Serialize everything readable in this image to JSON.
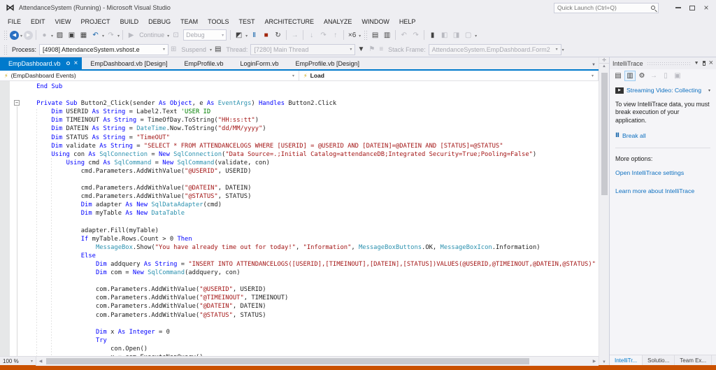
{
  "titlebar": {
    "title": "AttendanceSystem (Running) - Microsoft Visual Studio",
    "quick_launch_placeholder": "Quick Launch (Ctrl+Q)",
    "window_icons": [
      "search-icon",
      "minimize-icon",
      "maximize-icon",
      "close-icon"
    ]
  },
  "menubar": {
    "items": [
      "FILE",
      "EDIT",
      "VIEW",
      "PROJECT",
      "BUILD",
      "DEBUG",
      "TEAM",
      "TOOLS",
      "TEST",
      "ARCHITECTURE",
      "ANALYZE",
      "WINDOW",
      "HELP"
    ]
  },
  "toolbar": {
    "items": [
      {
        "type": "grip"
      },
      {
        "type": "icon",
        "name": "navigate-back-icon",
        "glyph": "◀",
        "variant": "circle-blue"
      },
      {
        "type": "dd"
      },
      {
        "type": "icon",
        "name": "navigate-forward-icon",
        "glyph": "▶",
        "variant": "circle-gray"
      },
      {
        "type": "sep"
      },
      {
        "type": "icon",
        "name": "new-project-icon",
        "glyph": "●",
        "variant": "disabled"
      },
      {
        "type": "dd"
      },
      {
        "type": "icon",
        "name": "open-file-icon",
        "glyph": "▨",
        "variant": "dark"
      },
      {
        "type": "icon",
        "name": "save-icon",
        "glyph": "▣",
        "variant": "dark"
      },
      {
        "type": "icon",
        "name": "save-all-icon",
        "glyph": "▦",
        "variant": "dark"
      },
      {
        "type": "icon",
        "name": "undo-icon",
        "glyph": "↶",
        "variant": "blue"
      },
      {
        "type": "dd"
      },
      {
        "type": "icon",
        "name": "redo-icon",
        "glyph": "↷",
        "variant": "disabled"
      },
      {
        "type": "dd"
      },
      {
        "type": "sep"
      },
      {
        "type": "icon",
        "name": "continue-icon",
        "glyph": "▶",
        "variant": "disabled"
      },
      {
        "type": "label",
        "name": "continue-button",
        "text": "Continue",
        "variant": "disabled"
      },
      {
        "type": "dd"
      },
      {
        "type": "icon",
        "name": "breakpoints-window-icon",
        "glyph": "⊡",
        "variant": "disabled"
      },
      {
        "type": "combo",
        "name": "solution-configurations-combo",
        "text": "Debug",
        "variant": "disabled"
      },
      {
        "type": "sep"
      },
      {
        "type": "icon",
        "name": "diagnostic-tools-icon",
        "glyph": "◩",
        "variant": "dark"
      },
      {
        "type": "dd"
      },
      {
        "type": "icon",
        "name": "break-all-icon",
        "glyph": "Ⅱ",
        "variant": "blue"
      },
      {
        "type": "icon",
        "name": "stop-debugging-icon",
        "glyph": "■",
        "variant": "red"
      },
      {
        "type": "icon",
        "name": "restart-icon",
        "glyph": "↻",
        "variant": "dark"
      },
      {
        "type": "sep"
      },
      {
        "type": "icon",
        "name": "show-next-statement-icon",
        "glyph": "→",
        "variant": "disabled"
      },
      {
        "type": "sep"
      },
      {
        "type": "icon",
        "name": "step-into-icon",
        "glyph": "↓",
        "variant": "disabled"
      },
      {
        "type": "icon",
        "name": "step-over-icon",
        "glyph": "↷",
        "variant": "disabled"
      },
      {
        "type": "icon",
        "name": "step-out-icon",
        "glyph": "↑",
        "variant": "disabled"
      },
      {
        "type": "sep"
      },
      {
        "type": "icon",
        "name": "hex-display-icon",
        "glyph": "×6",
        "variant": "dark"
      },
      {
        "type": "dd"
      },
      {
        "type": "grip"
      },
      {
        "type": "icon",
        "name": "memory-window-icon",
        "glyph": "▤",
        "variant": "dark"
      },
      {
        "type": "icon",
        "name": "watch-window-icon",
        "glyph": "▥",
        "variant": "dark"
      },
      {
        "type": "sep"
      },
      {
        "type": "icon",
        "name": "undo-close-icon",
        "glyph": "↶",
        "variant": "disabled"
      },
      {
        "type": "icon",
        "name": "redo-close-icon",
        "glyph": "↷",
        "variant": "disabled"
      },
      {
        "type": "sep"
      },
      {
        "type": "icon",
        "name": "toggle-bookmark-icon",
        "glyph": "▮",
        "variant": "dark"
      },
      {
        "type": "icon",
        "name": "prev-bookmark-icon",
        "glyph": "◧",
        "variant": "disabled"
      },
      {
        "type": "icon",
        "name": "next-bookmark-icon",
        "glyph": "◨",
        "variant": "disabled"
      },
      {
        "type": "icon",
        "name": "clear-bookmarks-icon",
        "glyph": "▢",
        "variant": "disabled"
      },
      {
        "type": "dd"
      }
    ]
  },
  "debug_location": {
    "process_label": "Process:",
    "process_value": "[4908] AttendanceSystem.vshost.e",
    "suspend_label": "Suspend",
    "thread_label": "Thread:",
    "thread_value": "[7280] Main Thread",
    "stack_frame_label": "Stack Frame:",
    "stack_frame_value": "AttendanceSystem.EmpDashboard.Form2",
    "icons": [
      "suspend-icon",
      "thread-icon",
      "filter-icon",
      "flag-icon",
      "stack-frame-icon"
    ]
  },
  "editor": {
    "tabs": [
      {
        "label": "EmpDashboard.vb",
        "active": true
      },
      {
        "label": "EmpDashboard.vb [Design]",
        "active": false
      },
      {
        "label": "EmpProfile.vb",
        "active": false
      },
      {
        "label": "LoginForm.vb",
        "active": false
      },
      {
        "label": "EmpProfile.vb [Design]",
        "active": false
      }
    ],
    "navbar_left": "(EmpDashboard Events)",
    "navbar_right": "Load",
    "zoom_level": "100 %",
    "code_lines": [
      [
        [
          "p",
          "    "
        ],
        [
          "k",
          "End Sub"
        ]
      ],
      [],
      [
        [
          "p",
          "    "
        ],
        [
          "k",
          "Private Sub"
        ],
        [
          "p",
          " Button2_Click(sender "
        ],
        [
          "k",
          "As"
        ],
        [
          "p",
          " "
        ],
        [
          "k",
          "Object"
        ],
        [
          "p",
          ", e "
        ],
        [
          "k",
          "As"
        ],
        [
          "p",
          " "
        ],
        [
          "t",
          "EventArgs"
        ],
        [
          "p",
          ") "
        ],
        [
          "k",
          "Handles"
        ],
        [
          "p",
          " Button2.Click"
        ]
      ],
      [
        [
          "p",
          "        "
        ],
        [
          "k",
          "Dim"
        ],
        [
          "p",
          " USERID "
        ],
        [
          "k",
          "As String"
        ],
        [
          "p",
          " = Label2.Text "
        ],
        [
          "c",
          "'USER ID"
        ]
      ],
      [
        [
          "p",
          "        "
        ],
        [
          "k",
          "Dim"
        ],
        [
          "p",
          " TIMEINOUT "
        ],
        [
          "k",
          "As String"
        ],
        [
          "p",
          " = TimeOfDay.ToString("
        ],
        [
          "s",
          "\"HH:ss:tt\""
        ],
        [
          "p",
          ")"
        ]
      ],
      [
        [
          "p",
          "        "
        ],
        [
          "k",
          "Dim"
        ],
        [
          "p",
          " DATEIN "
        ],
        [
          "k",
          "As String"
        ],
        [
          "p",
          " = "
        ],
        [
          "t",
          "DateTime"
        ],
        [
          "p",
          ".Now.ToString("
        ],
        [
          "s",
          "\"dd/MM/yyyy\""
        ],
        [
          "p",
          ")"
        ]
      ],
      [
        [
          "p",
          "        "
        ],
        [
          "k",
          "Dim"
        ],
        [
          "p",
          " STATUS "
        ],
        [
          "k",
          "As String"
        ],
        [
          "p",
          " = "
        ],
        [
          "s",
          "\"TimeOUT\""
        ]
      ],
      [
        [
          "p",
          "        "
        ],
        [
          "k",
          "Dim"
        ],
        [
          "p",
          " validate "
        ],
        [
          "k",
          "As String"
        ],
        [
          "p",
          " = "
        ],
        [
          "s",
          "\"SELECT * FROM ATTENDANCELOGS WHERE [USERID] = @USERID AND [DATEIN]=@DATEIN AND [STATUS]=@STATUS\""
        ]
      ],
      [
        [
          "p",
          "        "
        ],
        [
          "k",
          "Using"
        ],
        [
          "p",
          " con "
        ],
        [
          "k",
          "As"
        ],
        [
          "p",
          " "
        ],
        [
          "t",
          "SqlConnection"
        ],
        [
          "p",
          " = "
        ],
        [
          "k",
          "New"
        ],
        [
          "p",
          " "
        ],
        [
          "t",
          "SqlConnection"
        ],
        [
          "p",
          "("
        ],
        [
          "s",
          "\"Data Source=.;Initial Catalog=attendanceDB;Integrated Security=True;Pooling=False\""
        ],
        [
          "p",
          ")"
        ]
      ],
      [
        [
          "p",
          "            "
        ],
        [
          "k",
          "Using"
        ],
        [
          "p",
          " cmd "
        ],
        [
          "k",
          "As"
        ],
        [
          "p",
          " "
        ],
        [
          "t",
          "SqlCommand"
        ],
        [
          "p",
          " = "
        ],
        [
          "k",
          "New"
        ],
        [
          "p",
          " "
        ],
        [
          "t",
          "SqlCommand"
        ],
        [
          "p",
          "(validate, con)"
        ]
      ],
      [
        [
          "p",
          "                cmd.Parameters.AddWithValue("
        ],
        [
          "s",
          "\"@USERID\""
        ],
        [
          "p",
          ", USERID)"
        ]
      ],
      [],
      [
        [
          "p",
          "                cmd.Parameters.AddWithValue("
        ],
        [
          "s",
          "\"@DATEIN\""
        ],
        [
          "p",
          ", DATEIN)"
        ]
      ],
      [
        [
          "p",
          "                cmd.Parameters.AddWithValue("
        ],
        [
          "s",
          "\"@STATUS\""
        ],
        [
          "p",
          ", STATUS)"
        ]
      ],
      [
        [
          "p",
          "                "
        ],
        [
          "k",
          "Dim"
        ],
        [
          "p",
          " adapter "
        ],
        [
          "k",
          "As New"
        ],
        [
          "p",
          " "
        ],
        [
          "t",
          "SqlDataAdapter"
        ],
        [
          "p",
          "(cmd)"
        ]
      ],
      [
        [
          "p",
          "                "
        ],
        [
          "k",
          "Dim"
        ],
        [
          "p",
          " myTable "
        ],
        [
          "k",
          "As New"
        ],
        [
          "p",
          " "
        ],
        [
          "t",
          "DataTable"
        ]
      ],
      [],
      [
        [
          "p",
          "                adapter.Fill(myTable)"
        ]
      ],
      [
        [
          "p",
          "                "
        ],
        [
          "k",
          "If"
        ],
        [
          "p",
          " myTable.Rows.Count > 0 "
        ],
        [
          "k",
          "Then"
        ]
      ],
      [
        [
          "p",
          "                    "
        ],
        [
          "t",
          "MessageBox"
        ],
        [
          "p",
          ".Show("
        ],
        [
          "s",
          "\"You have already time out for today!\""
        ],
        [
          "p",
          ", "
        ],
        [
          "s",
          "\"Information\""
        ],
        [
          "p",
          ", "
        ],
        [
          "t",
          "MessageBoxButtons"
        ],
        [
          "p",
          ".OK, "
        ],
        [
          "t",
          "MessageBoxIcon"
        ],
        [
          "p",
          ".Information)"
        ]
      ],
      [
        [
          "p",
          "                "
        ],
        [
          "k",
          "Else"
        ]
      ],
      [
        [
          "p",
          "                    "
        ],
        [
          "k",
          "Dim"
        ],
        [
          "p",
          " addquery "
        ],
        [
          "k",
          "As String"
        ],
        [
          "p",
          " = "
        ],
        [
          "s",
          "\"INSERT INTO ATTENDANCELOGS([USERID],[TIMEINOUT],[DATEIN],[STATUS])VALUES(@USERID,@TIMEINOUT,@DATEIN,@STATUS)\""
        ]
      ],
      [
        [
          "p",
          "                    "
        ],
        [
          "k",
          "Dim"
        ],
        [
          "p",
          " com = "
        ],
        [
          "k",
          "New"
        ],
        [
          "p",
          " "
        ],
        [
          "t",
          "SqlCommand"
        ],
        [
          "p",
          "(addquery, con)"
        ]
      ],
      [],
      [
        [
          "p",
          "                    com.Parameters.AddWithValue("
        ],
        [
          "s",
          "\"@USERID\""
        ],
        [
          "p",
          ", USERID)"
        ]
      ],
      [
        [
          "p",
          "                    com.Parameters.AddWithValue("
        ],
        [
          "s",
          "\"@TIMEINOUT\""
        ],
        [
          "p",
          ", TIMEINOUT)"
        ]
      ],
      [
        [
          "p",
          "                    com.Parameters.AddWithValue("
        ],
        [
          "s",
          "\"@DATEIN\""
        ],
        [
          "p",
          ", DATEIN)"
        ]
      ],
      [
        [
          "p",
          "                    com.Parameters.AddWithValue("
        ],
        [
          "s",
          "\"@STATUS\""
        ],
        [
          "p",
          ", STATUS)"
        ]
      ],
      [],
      [
        [
          "p",
          "                    "
        ],
        [
          "k",
          "Dim"
        ],
        [
          "p",
          " x "
        ],
        [
          "k",
          "As Integer"
        ],
        [
          "p",
          " = 0"
        ]
      ],
      [
        [
          "p",
          "                    "
        ],
        [
          "k",
          "Try"
        ]
      ],
      [
        [
          "p",
          "                        con.Open()"
        ]
      ],
      [
        [
          "p",
          "                        x = com.ExecuteNonQuery()"
        ]
      ]
    ]
  },
  "intellitrace": {
    "title": "IntelliTrace",
    "toolbar": [
      {
        "name": "events-view-icon",
        "glyph": "▤",
        "variant": "dark",
        "selected": false
      },
      {
        "name": "calls-view-icon",
        "glyph": "▥",
        "variant": "dark",
        "selected": true
      },
      {
        "name": "settings-gear-icon",
        "glyph": "⚙",
        "variant": "dark",
        "selected": false
      },
      {
        "name": "goto-event-icon",
        "glyph": "→",
        "variant": "disabled",
        "selected": false
      },
      {
        "name": "open-log-icon",
        "glyph": "▯",
        "variant": "disabled",
        "selected": false
      },
      {
        "name": "save-log-icon",
        "glyph": "▣",
        "variant": "disabled",
        "selected": false
      }
    ],
    "streaming_link": "Streaming Video: Collecting",
    "note": "To view IntelliTrace data, you must break execution of your application.",
    "break_all": "Break all",
    "more_options": "More options:",
    "settings_link": "Open IntelliTrace settings",
    "learn_link": "Learn more about IntelliTrace"
  },
  "side_tabs": [
    {
      "label": "IntelliTr...",
      "active": true
    },
    {
      "label": "Solutio...",
      "active": false
    },
    {
      "label": "Team Ex...",
      "active": false
    }
  ],
  "colors": {
    "accent": "#007acc",
    "status_bar_debug": "#ca5100",
    "keyword": "#0000ff",
    "type": "#2b91af",
    "string": "#a31515",
    "comment": "#008000",
    "editor_margin": "#e6e7e8"
  }
}
